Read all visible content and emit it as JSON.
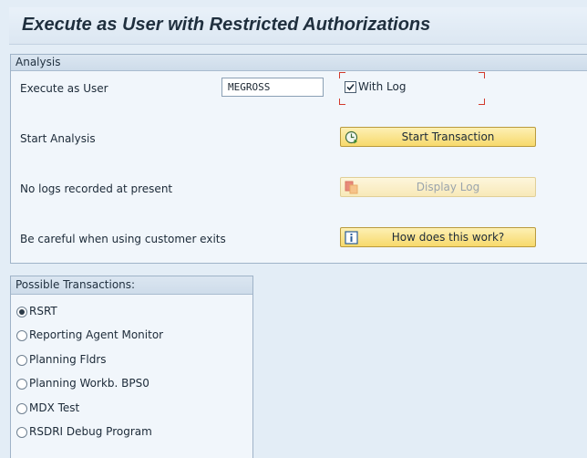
{
  "window": {
    "title": "Execute as User with Restricted Authorizations"
  },
  "analysis": {
    "header": "Analysis",
    "execute_as_user_label": "Execute as User",
    "user_value": "MEGROSS",
    "with_log_label": "With Log",
    "with_log_checked": true,
    "start_analysis_label": "Start Analysis",
    "start_transaction_label": "Start Transaction",
    "no_logs_label": "No logs recorded at present",
    "display_log_label": "Display Log",
    "customer_exits_label": "Be careful when using customer exits",
    "how_does_this_work_label": "How does this work?",
    "icons": {
      "start": "clock-execute-icon",
      "display_log": "log-icon",
      "info": "info-icon"
    }
  },
  "transactions": {
    "header": "Possible Transactions:",
    "options": [
      {
        "label": "RSRT",
        "selected": true
      },
      {
        "label": "Reporting Agent Monitor",
        "selected": false
      },
      {
        "label": "Planning Fldrs",
        "selected": false
      },
      {
        "label": "Planning Workb. BPS0",
        "selected": false
      },
      {
        "label": "MDX Test",
        "selected": false
      },
      {
        "label": "RSDRI Debug Program",
        "selected": false
      }
    ]
  },
  "colors": {
    "background": "#e3edf6",
    "button": "#f7d96b",
    "focus_corner": "#d23a2c"
  }
}
